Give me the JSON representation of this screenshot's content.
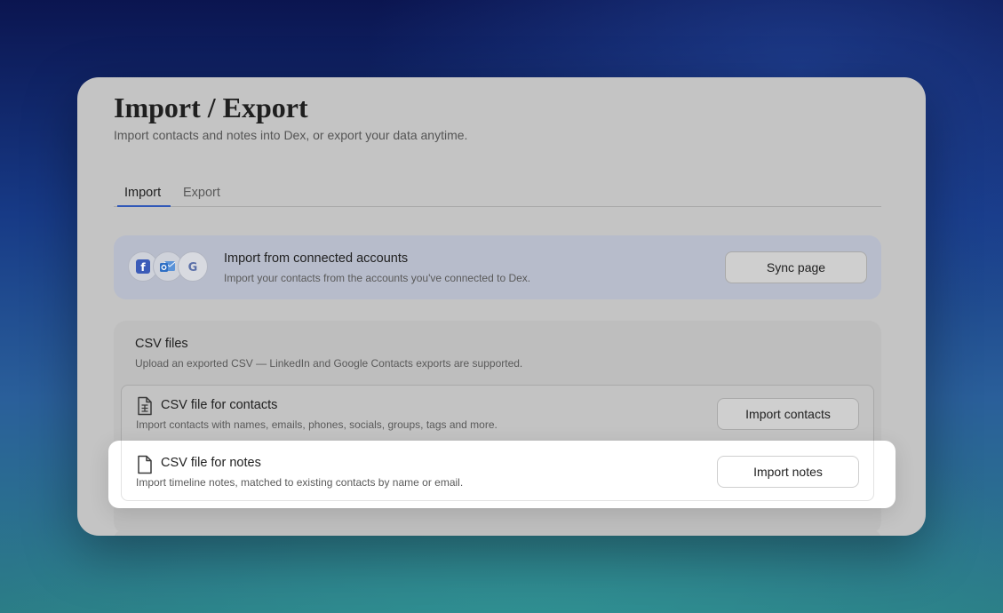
{
  "page": {
    "title": "Import / Export",
    "subtitle": "Import contacts and notes into Dex, or export your data anytime."
  },
  "tabs": [
    {
      "label": "Import",
      "active": true
    },
    {
      "label": "Export",
      "active": false
    }
  ],
  "connected": {
    "title": "Import from connected accounts",
    "description": "Import your contacts from the accounts you've connected to Dex.",
    "button_label": "Sync page",
    "icons": [
      "facebook-icon",
      "outlook-icon",
      "google-icon"
    ],
    "google_glyph": "G",
    "facebook_glyph": "f"
  },
  "csv": {
    "title": "CSV files",
    "description": "Upload an exported CSV — LinkedIn and Google Contacts exports are supported.",
    "rows": [
      {
        "title": "CSV file for contacts",
        "description": "Import contacts with names, emails, phones, socials, groups, tags and more.",
        "button_label": "Import contacts"
      },
      {
        "title": "CSV file for notes",
        "description": "Import timeline notes, matched to existing contacts by name or email.",
        "button_label": "Import notes",
        "highlighted": true
      }
    ]
  },
  "colors": {
    "tab_underline": "#3158b8",
    "facebook": "#3b5bb8",
    "outlook": "#2f6fc4"
  }
}
